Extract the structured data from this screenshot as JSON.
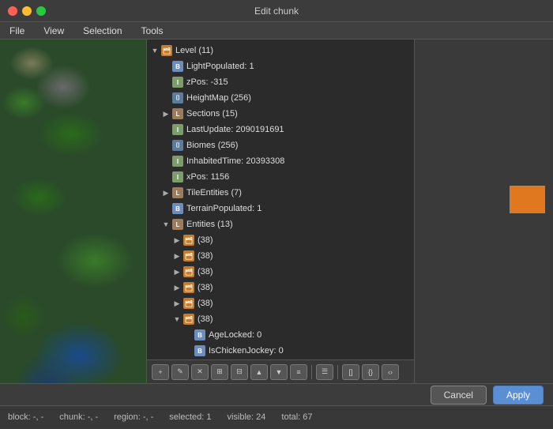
{
  "titleBar": {
    "title": "Edit chunk"
  },
  "menuBar": {
    "items": [
      "File",
      "View",
      "Selection",
      "Tools"
    ]
  },
  "treeView": {
    "items": [
      {
        "level": 0,
        "indent": 0,
        "arrow": "expanded",
        "iconType": "folder",
        "label": "Level (11)"
      },
      {
        "level": 1,
        "indent": 1,
        "arrow": "none",
        "iconType": "byte",
        "label": "LightPopulated: 1"
      },
      {
        "level": 1,
        "indent": 1,
        "arrow": "none",
        "iconType": "int",
        "label": "zPos: -315"
      },
      {
        "level": 1,
        "indent": 1,
        "arrow": "none",
        "iconType": "bytearray",
        "label": "HeightMap (256)"
      },
      {
        "level": 1,
        "indent": 1,
        "arrow": "collapsed",
        "iconType": "list",
        "label": "Sections (15)"
      },
      {
        "level": 1,
        "indent": 1,
        "arrow": "none",
        "iconType": "int",
        "label": "LastUpdate: 2090191691"
      },
      {
        "level": 1,
        "indent": 1,
        "arrow": "none",
        "iconType": "bytearray",
        "label": "Biomes (256)"
      },
      {
        "level": 1,
        "indent": 1,
        "arrow": "none",
        "iconType": "int",
        "label": "InhabitedTime: 20393308"
      },
      {
        "level": 1,
        "indent": 1,
        "arrow": "none",
        "iconType": "int",
        "label": "xPos: 1156"
      },
      {
        "level": 1,
        "indent": 1,
        "arrow": "collapsed",
        "iconType": "list",
        "label": "TileEntities (7)"
      },
      {
        "level": 1,
        "indent": 1,
        "arrow": "none",
        "iconType": "byte",
        "label": "TerrainPopulated: 1"
      },
      {
        "level": 1,
        "indent": 1,
        "arrow": "expanded",
        "iconType": "list",
        "label": "Entities (13)"
      },
      {
        "level": 2,
        "indent": 2,
        "arrow": "collapsed",
        "iconType": "folder",
        "label": "(38)"
      },
      {
        "level": 2,
        "indent": 2,
        "arrow": "collapsed",
        "iconType": "folder",
        "label": "(38)"
      },
      {
        "level": 2,
        "indent": 2,
        "arrow": "collapsed",
        "iconType": "folder",
        "label": "(38)"
      },
      {
        "level": 2,
        "indent": 2,
        "arrow": "collapsed",
        "iconType": "folder",
        "label": "(38)"
      },
      {
        "level": 2,
        "indent": 2,
        "arrow": "collapsed",
        "iconType": "folder",
        "label": "(38)"
      },
      {
        "level": 2,
        "indent": 2,
        "arrow": "expanded",
        "iconType": "folder",
        "label": "(38)"
      },
      {
        "level": 3,
        "indent": 3,
        "arrow": "none",
        "iconType": "byte",
        "label": "AgeLocked: 0"
      },
      {
        "level": 3,
        "indent": 3,
        "arrow": "none",
        "iconType": "byte",
        "label": "IsChickenJockey: 0"
      }
    ]
  },
  "toolbar": {
    "buttons": [
      "img",
      "img2",
      "img3",
      "img4",
      "img5",
      "img6",
      "img7",
      "img8",
      "sep",
      "list",
      "sep2",
      "arr1",
      "arr2",
      "arr3"
    ]
  },
  "footer": {
    "cancelLabel": "Cancel",
    "applyLabel": "Apply"
  },
  "statusBar": {
    "block": "block: -, -",
    "chunk": "chunk: -, -",
    "region": "region: -, -",
    "selected": "selected: 1",
    "visible": "visible: 24",
    "total": "total: 67"
  }
}
